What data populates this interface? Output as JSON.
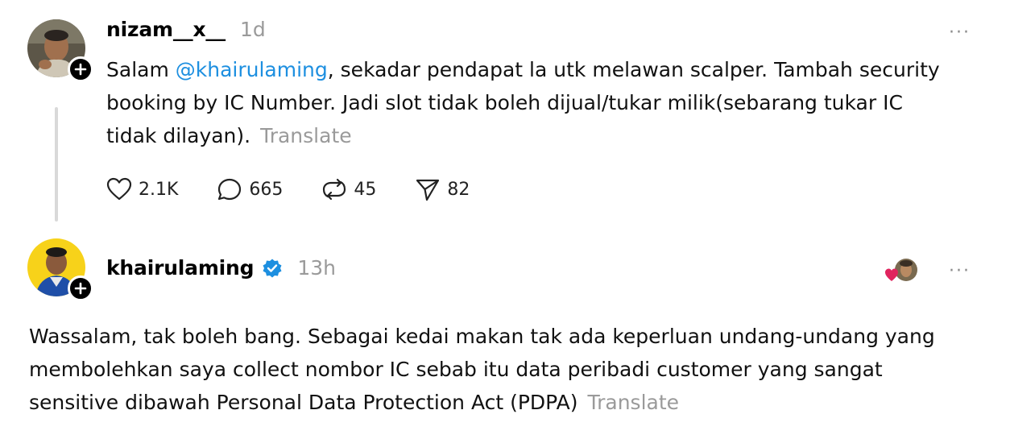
{
  "post1": {
    "username": "nizam__x__",
    "time": "1d",
    "more_label": "···",
    "text_prefix": "Salam ",
    "mention": "@khairulaming",
    "text_line1_rest": ", sekadar pendapat la utk melawan scalper. Tambah security",
    "text_line2": "booking by IC Number. Jadi slot tidak boleh dijual/tukar milik(sebarang tukar IC",
    "text_line3": "tidak dilayan).",
    "translate": "Translate",
    "stats": {
      "likes": "2.1K",
      "replies": "665",
      "reposts": "45",
      "shares": "82"
    }
  },
  "post2": {
    "username": "khairulaming",
    "time": "13h",
    "more_label": "···",
    "text_line1": "Wassalam, tak boleh bang. Sebagai kedai makan tak ada keperluan undang-undang yang",
    "text_line2": "membolehkan saya collect nombor IC sebab itu data peribadi customer yang sangat",
    "text_line3": "sensitive dibawah Personal Data Protection Act (PDPA)",
    "translate": "Translate"
  },
  "icons": {
    "like": "heart-icon",
    "reply": "comment-icon",
    "repost": "repost-icon",
    "share": "share-icon",
    "verified": "verified-badge-icon",
    "follow": "plus-icon"
  },
  "colors": {
    "mention": "#1d8fe0",
    "muted": "#9a9a9a",
    "verified": "#1d8fe0",
    "liked_heart": "#e0245e"
  }
}
